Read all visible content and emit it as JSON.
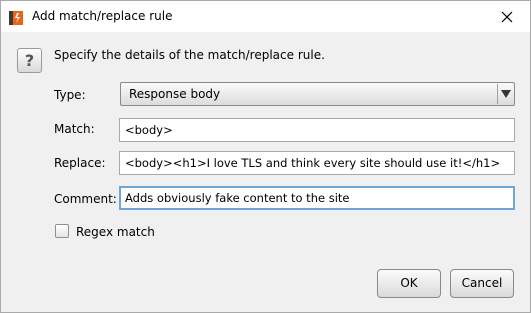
{
  "window": {
    "title": "Add match/replace rule",
    "icon": "burp-icon"
  },
  "heading": "Specify the details of the match/replace rule.",
  "form": {
    "type_label": "Type:",
    "type_value": "Response body",
    "match_label": "Match:",
    "match_value": "<body>",
    "replace_label": "Replace:",
    "replace_value": "<body><h1>I love TLS and think every site should use it!</h1>",
    "comment_label": "Comment:",
    "comment_value": "Adds obviously fake content to the site",
    "regex_label": "Regex match",
    "regex_checked": false
  },
  "buttons": {
    "ok": "OK",
    "cancel": "Cancel"
  },
  "help_glyph": "?",
  "colors": {
    "accent_orange": "#e8661a",
    "focus_border": "#6fa6d6"
  }
}
